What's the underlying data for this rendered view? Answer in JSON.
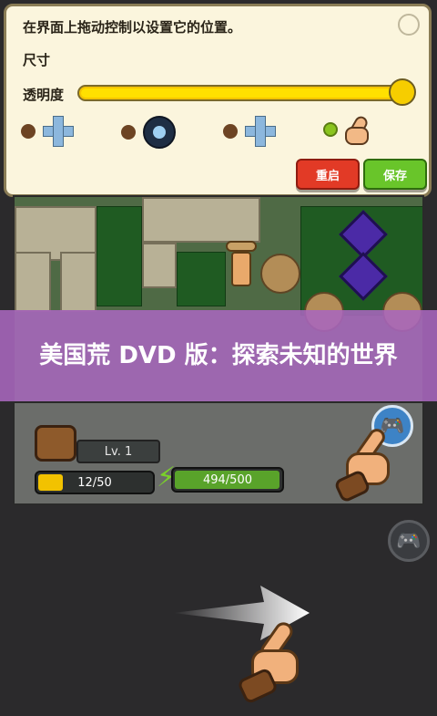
{
  "settings": {
    "title": "在界面上拖动控制以设置它的位置。",
    "size_label": "尺寸",
    "opacity_label": "透明度",
    "opacity_level": 1.0,
    "layout_options": [
      "dpad-icon",
      "joystick-icon",
      "dpad-icon",
      "touch-hand-icon"
    ],
    "selected_option": 3,
    "restart_button": "重启",
    "save_button": "保存"
  },
  "banner": {
    "text": "美国荒 DVD 版：探索未知的世界"
  },
  "hud": {
    "level": "Lv. 1",
    "exp": "12/50",
    "exp_fraction": 0.24,
    "energy": "494/500",
    "energy_fraction": 0.988
  },
  "colors": {
    "accent_yellow": "#f4c400",
    "restart_red": "#e23a26",
    "save_green": "#69c52a",
    "banner_purple": "#a866be",
    "gamepad_blue": "#3d83c6"
  }
}
